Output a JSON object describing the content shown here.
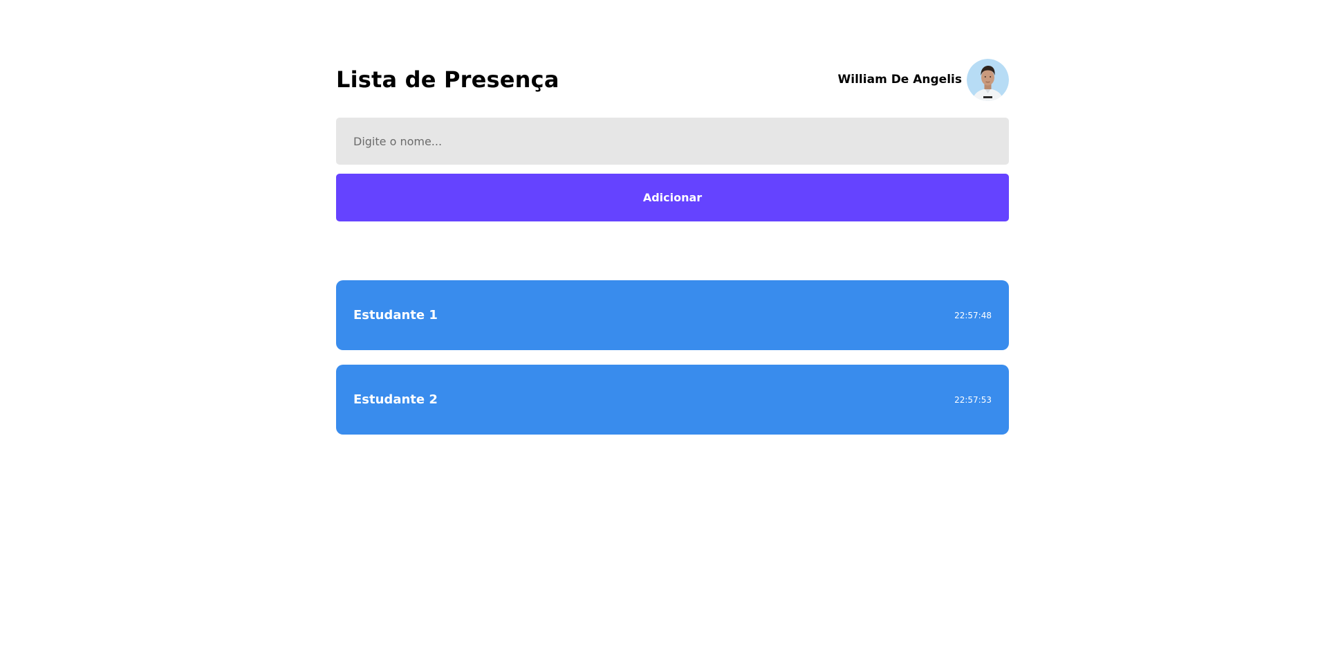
{
  "page": {
    "title": "Lista de Presença"
  },
  "user": {
    "name": "William De Angelis",
    "avatar_icon": "user-photo-avatar"
  },
  "form": {
    "input_placeholder": "Digite o nome...",
    "input_value": "",
    "add_label": "Adicionar"
  },
  "students": [
    {
      "name": "Estudante 1",
      "time": "22:57:48"
    },
    {
      "name": "Estudante 2",
      "time": "22:57:53"
    }
  ],
  "colors": {
    "background": "#ffffff",
    "input_background": "#e6e6e6",
    "button": "#6543ff",
    "card": "#398ced",
    "text_dark": "#000000",
    "text_light": "#ffffff"
  }
}
